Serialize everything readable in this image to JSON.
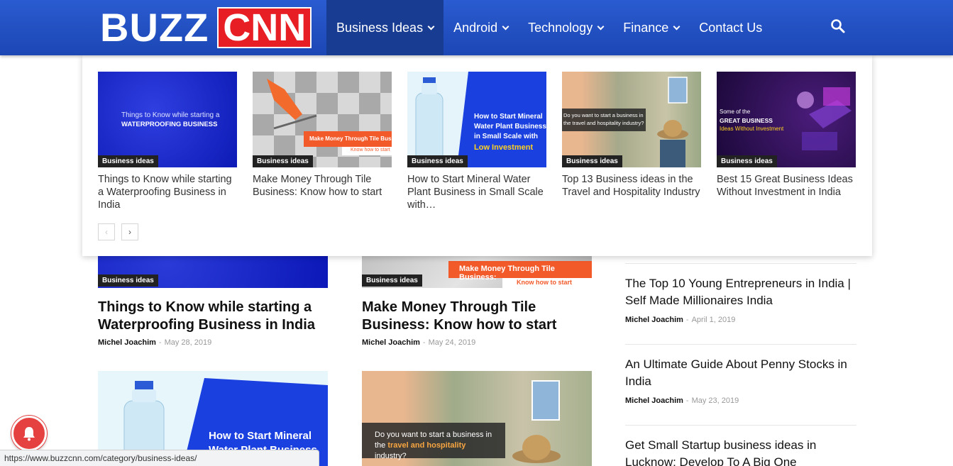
{
  "header": {
    "logo_left": "BUZZ",
    "logo_right": "CNN",
    "nav": [
      {
        "label": "Business Ideas",
        "has_dropdown": true,
        "active": true
      },
      {
        "label": "Android",
        "has_dropdown": true
      },
      {
        "label": "Technology",
        "has_dropdown": true
      },
      {
        "label": "Finance",
        "has_dropdown": true
      },
      {
        "label": "Contact Us",
        "has_dropdown": false
      }
    ],
    "search_icon": "search-icon"
  },
  "mega_menu": {
    "items": [
      {
        "category": "Business ideas",
        "title": "Things to Know while starting a Waterproofing Business in India",
        "image_text": [
          "Things to Know while starting a",
          "WATERPROOFING BUSINESS"
        ]
      },
      {
        "category": "Business ideas",
        "title": "Make Money Through Tile Business: Know how to start",
        "image_text": [
          "Make Money Through Tile Business:",
          "Know how to start"
        ]
      },
      {
        "category": "Business ideas",
        "title": "How to Start Mineral Water Plant Business in Small Scale with…",
        "image_text": [
          "How to Start Mineral",
          "Water Plant Business",
          "in Small Scale with",
          "Low Investment"
        ]
      },
      {
        "category": "Business ideas",
        "title": "Top 13 Business ideas in the Travel and Hospitality Industry",
        "image_text": [
          "Do you want to start a business in",
          "the travel and hospitality industry?"
        ]
      },
      {
        "category": "Business ideas",
        "title": "Best 15 Great Business Ideas Without Investment in India",
        "image_text": [
          "Some of the",
          "GREAT BUSINESS",
          "Ideas Without Investment"
        ]
      }
    ],
    "prev": "‹",
    "next": "›"
  },
  "main": {
    "posts": [
      {
        "category": "Business ideas",
        "title": "Things to Know while starting a Waterproofing Business in India",
        "author": "Michel Joachim",
        "date": "May 28, 2019"
      },
      {
        "category": "Business ideas",
        "title": "Make Money Through Tile Business: Know how to start",
        "author": "Michel Joachim",
        "date": "May 24, 2019",
        "image_text": [
          "Make Money Through Tile Business:",
          "Know how to start"
        ]
      }
    ],
    "lower_posts": [
      {
        "image_text": [
          "How to Start Mineral",
          "Water Plant Business"
        ]
      },
      {
        "image_text": [
          "Do you want to start a business in",
          "the ",
          "travel and hospitality",
          " industry?"
        ]
      }
    ]
  },
  "sidebar": {
    "items": [
      {
        "title": "The Top 10 Young Entrepreneurs in India | Self Made Millionaires India",
        "author": "Michel Joachim",
        "date": "April 1, 2019"
      },
      {
        "title": "An Ultimate Guide About Penny Stocks in India",
        "author": "Michel Joachim",
        "date": "May 23, 2019"
      },
      {
        "title": "Get Small Startup business ideas in Lucknow: Develop To A Big One"
      }
    ]
  },
  "status_url": "https://www.buzzcnn.com/category/business-ideas/",
  "colors": {
    "header": "#1c47b5",
    "logo_red": "#e81e25",
    "accent_orange": "#f25a2a",
    "bell": "#e54141"
  }
}
